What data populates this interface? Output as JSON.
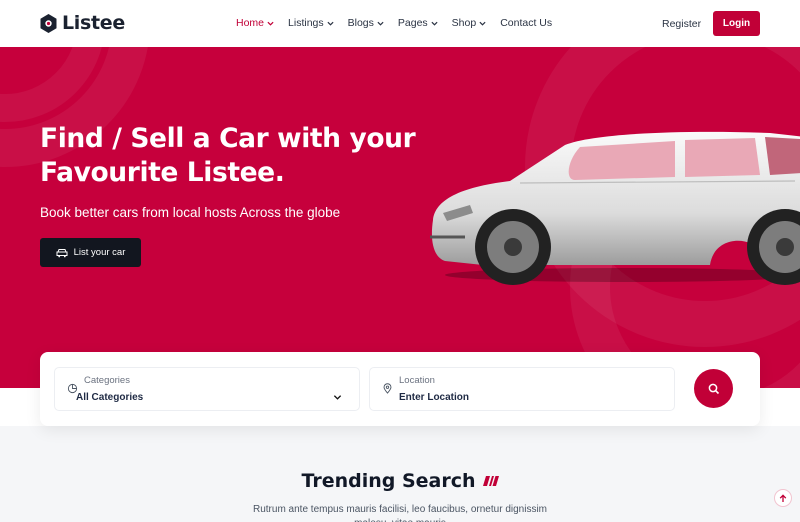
{
  "brand": {
    "name": "Listee",
    "accent": "#c10037",
    "hero_bg": "#c6003c"
  },
  "nav": {
    "items": [
      {
        "label": "Home",
        "active": true,
        "has_dropdown": true
      },
      {
        "label": "Listings",
        "active": false,
        "has_dropdown": true
      },
      {
        "label": "Blogs",
        "active": false,
        "has_dropdown": true
      },
      {
        "label": "Pages",
        "active": false,
        "has_dropdown": true
      },
      {
        "label": "Shop",
        "active": false,
        "has_dropdown": true
      },
      {
        "label": "Contact Us",
        "active": false,
        "has_dropdown": false
      }
    ],
    "register_label": "Register",
    "login_label": "Login"
  },
  "hero": {
    "title": "Find / Sell a Car with your Favourite Listee.",
    "subtitle": "Book better cars from local hosts Across the globe",
    "cta_label": "List your car",
    "cta_icon": "car-icon"
  },
  "search": {
    "category": {
      "label": "Categories",
      "value": "All Categories",
      "icon": "category-icon"
    },
    "location": {
      "label": "Location",
      "placeholder": "Enter Location",
      "icon": "map-pin-icon"
    },
    "button_icon": "search-icon"
  },
  "trending": {
    "title": "Trending Search",
    "text": "Rutrum ante tempus mauris facilisi, leo faucibus, ornetur dignissim malesu, vitae mauris"
  }
}
